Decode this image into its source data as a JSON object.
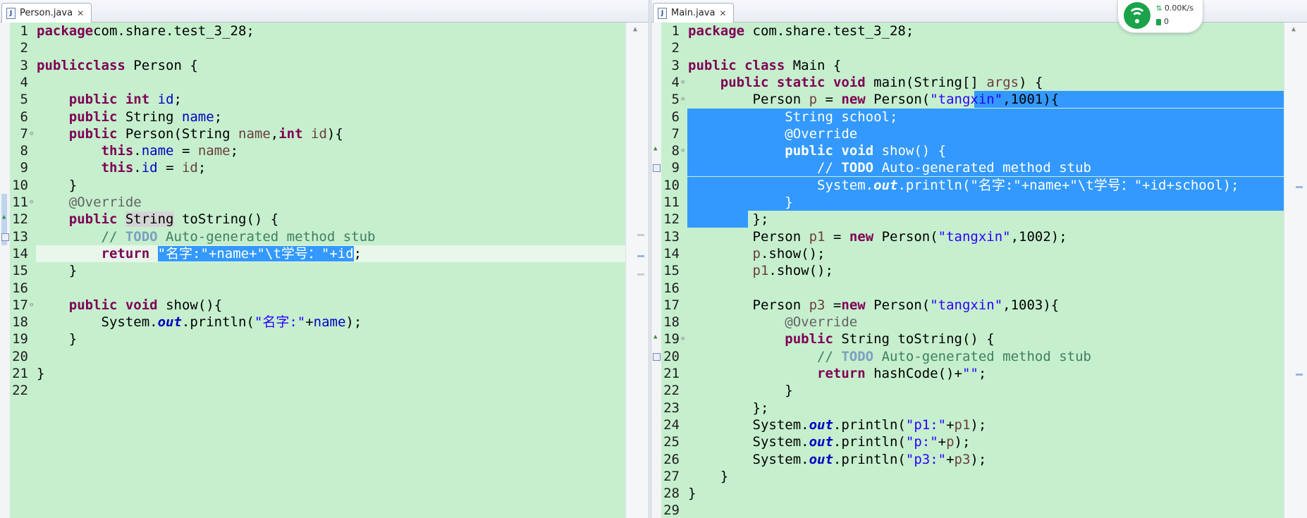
{
  "left_editor": {
    "tab_label": "Person.java",
    "line_numbers": [
      "1",
      "2",
      "3",
      "4",
      "5",
      "6",
      "7",
      "8",
      "9",
      "10",
      "11",
      "12",
      "13",
      "14",
      "15",
      "16",
      "17",
      "18",
      "19",
      "20",
      "21",
      "22"
    ],
    "lines": [
      [
        [
          "kw",
          "package"
        ],
        [
          "",
          "com.share.test_3_28;"
        ]
      ],
      [],
      [
        [
          "kw",
          "public"
        ],
        [
          "",
          ""
        ],
        [
          "kw",
          "class"
        ],
        [
          "",
          " Person {"
        ]
      ],
      [],
      [
        [
          "",
          "    "
        ],
        [
          "kw",
          "public"
        ],
        [
          "",
          " "
        ],
        [
          "kw",
          "int"
        ],
        [
          "",
          " "
        ],
        [
          "fld",
          "id"
        ],
        [
          "",
          ";"
        ]
      ],
      [
        [
          "",
          "    "
        ],
        [
          "kw",
          "public"
        ],
        [
          "",
          " String "
        ],
        [
          "fld",
          "name"
        ],
        [
          "",
          ";"
        ]
      ],
      [
        [
          "",
          "    "
        ],
        [
          "kw",
          "public"
        ],
        [
          "",
          " Person(String "
        ],
        [
          "vname",
          "name"
        ],
        [
          "",
          ","
        ],
        [
          "kw",
          "int"
        ],
        [
          "",
          " "
        ],
        [
          "vname",
          "id"
        ],
        [
          "",
          "){"
        ]
      ],
      [
        [
          "",
          "        "
        ],
        [
          "kw",
          "this"
        ],
        [
          "",
          "."
        ],
        [
          "fld",
          "name"
        ],
        [
          "",
          " = "
        ],
        [
          "vname",
          "name"
        ],
        [
          "",
          ";"
        ]
      ],
      [
        [
          "",
          "        "
        ],
        [
          "kw",
          "this"
        ],
        [
          "",
          "."
        ],
        [
          "fld",
          "id"
        ],
        [
          "",
          " = "
        ],
        [
          "vname",
          "id"
        ],
        [
          "",
          ";"
        ]
      ],
      [
        [
          "",
          "    }"
        ]
      ],
      [
        [
          "",
          "    "
        ],
        [
          "ann",
          "@Override"
        ]
      ],
      [
        [
          "",
          "    "
        ],
        [
          "kw",
          "public"
        ],
        [
          "",
          " "
        ],
        [
          "hl",
          "String"
        ],
        [
          "",
          " toString() {"
        ]
      ],
      [
        [
          "",
          "        "
        ],
        [
          "cm",
          "// "
        ],
        [
          "todo",
          "TODO"
        ],
        [
          "cm",
          " Auto-generated method stub"
        ]
      ],
      [
        [
          "",
          "        "
        ],
        [
          "kw",
          "return"
        ],
        [
          "",
          " "
        ],
        [
          "sel",
          "\"名字:\"+name+\"\\t学号：\"+id"
        ],
        [
          "",
          ";"
        ]
      ],
      [
        [
          "",
          "    }"
        ]
      ],
      [],
      [
        [
          "",
          "    "
        ],
        [
          "kw",
          "public"
        ],
        [
          "",
          " "
        ],
        [
          "kw",
          "void"
        ],
        [
          "",
          " show(){"
        ]
      ],
      [
        [
          "",
          "        System."
        ],
        [
          "sf",
          "out"
        ],
        [
          "",
          ".println("
        ],
        [
          "str",
          "\"名字:\""
        ],
        [
          "",
          "+"
        ],
        [
          "fld",
          "name"
        ],
        [
          "",
          ");"
        ]
      ],
      [
        [
          "",
          "    }"
        ]
      ],
      [],
      [
        [
          "",
          "}"
        ]
      ],
      []
    ]
  },
  "right_editor": {
    "tab_label": "Main.java",
    "line_numbers": [
      "1",
      "2",
      "3",
      "4",
      "5",
      "6",
      "7",
      "8",
      "9",
      "10",
      "11",
      "12",
      "13",
      "14",
      "15",
      "16",
      "17",
      "18",
      "19",
      "20",
      "21",
      "22",
      "23",
      "24",
      "25",
      "26",
      "27",
      "28",
      "29"
    ],
    "lines": [
      [
        [
          "kw",
          "package"
        ],
        [
          "",
          " com.share.test_3_28;"
        ]
      ],
      [],
      [
        [
          "kw",
          "public"
        ],
        [
          "",
          " "
        ],
        [
          "kw",
          "class"
        ],
        [
          "",
          " Main {"
        ]
      ],
      [
        [
          "",
          "    "
        ],
        [
          "kw",
          "public"
        ],
        [
          "",
          " "
        ],
        [
          "kw",
          "static"
        ],
        [
          "",
          " "
        ],
        [
          "kw",
          "void"
        ],
        [
          "",
          " main(String[] "
        ],
        [
          "vname",
          "args"
        ],
        [
          "",
          ") {"
        ]
      ],
      [
        [
          "",
          "        Person "
        ],
        [
          "vname",
          "p"
        ],
        [
          "",
          " = "
        ],
        [
          "kw",
          "new"
        ],
        [
          "",
          " Person("
        ],
        [
          "str",
          "\"tangxin\""
        ],
        [
          "",
          ",1001){"
        ]
      ],
      [
        [
          "",
          "            String "
        ],
        [
          "fld",
          "school"
        ],
        [
          "",
          ";"
        ]
      ],
      [
        [
          "",
          "            "
        ],
        [
          "ann",
          "@Override"
        ]
      ],
      [
        [
          "",
          "            "
        ],
        [
          "kw",
          "public"
        ],
        [
          "",
          " "
        ],
        [
          "kw",
          "void"
        ],
        [
          "",
          " show() {"
        ]
      ],
      [
        [
          "",
          "                "
        ],
        [
          "cm",
          "// "
        ],
        [
          "todo",
          "TODO"
        ],
        [
          "cm",
          " Auto-generated method stub"
        ]
      ],
      [
        [
          "",
          "                System."
        ],
        [
          "sf",
          "out"
        ],
        [
          "",
          ".println("
        ],
        [
          "str",
          "\"名字:\""
        ],
        [
          "",
          "+"
        ],
        [
          "fld",
          "name"
        ],
        [
          "",
          "+"
        ],
        [
          "str",
          "\"\\t学号：\""
        ],
        [
          "",
          "+"
        ],
        [
          "fld",
          "id"
        ],
        [
          "",
          "+"
        ],
        [
          "fld",
          "school"
        ],
        [
          "",
          ");"
        ]
      ],
      [
        [
          "",
          "            }"
        ]
      ],
      [
        [
          "",
          "        };"
        ]
      ],
      [
        [
          "",
          "        Person "
        ],
        [
          "vname",
          "p1"
        ],
        [
          "",
          " = "
        ],
        [
          "kw",
          "new"
        ],
        [
          "",
          " Person("
        ],
        [
          "str",
          "\"tangxin\""
        ],
        [
          "",
          ",1002);"
        ]
      ],
      [
        [
          "",
          "        "
        ],
        [
          "vname",
          "p"
        ],
        [
          "",
          ".show();"
        ]
      ],
      [
        [
          "",
          "        "
        ],
        [
          "vname",
          "p1"
        ],
        [
          "",
          ".show();"
        ]
      ],
      [],
      [
        [
          "",
          "        Person "
        ],
        [
          "vname",
          "p3"
        ],
        [
          "",
          " ="
        ],
        [
          "kw",
          "new"
        ],
        [
          "",
          " Person("
        ],
        [
          "str",
          "\"tangxin\""
        ],
        [
          "",
          ",1003){"
        ]
      ],
      [
        [
          "",
          "            "
        ],
        [
          "ann",
          "@Override"
        ]
      ],
      [
        [
          "",
          "            "
        ],
        [
          "kw",
          "public"
        ],
        [
          "",
          " String toString() {"
        ]
      ],
      [
        [
          "",
          "                "
        ],
        [
          "cm",
          "// "
        ],
        [
          "todo",
          "TODO"
        ],
        [
          "cm",
          " Auto-generated method stub"
        ]
      ],
      [
        [
          "",
          "                "
        ],
        [
          "kw",
          "return"
        ],
        [
          "",
          " hashCode()+"
        ],
        [
          "str",
          "\"\""
        ],
        [
          "",
          ";"
        ]
      ],
      [
        [
          "",
          "            }"
        ]
      ],
      [
        [
          "",
          "        };"
        ]
      ],
      [
        [
          "",
          "        System."
        ],
        [
          "sf",
          "out"
        ],
        [
          "",
          ".println("
        ],
        [
          "str",
          "\"p1:\""
        ],
        [
          "",
          "+"
        ],
        [
          "vname",
          "p1"
        ],
        [
          "",
          ");"
        ]
      ],
      [
        [
          "",
          "        System."
        ],
        [
          "sf",
          "out"
        ],
        [
          "",
          ".println("
        ],
        [
          "str",
          "\"p:\""
        ],
        [
          "",
          "+"
        ],
        [
          "vname",
          "p"
        ],
        [
          "",
          ");"
        ]
      ],
      [
        [
          "",
          "        System."
        ],
        [
          "sf",
          "out"
        ],
        [
          "",
          ".println("
        ],
        [
          "str",
          "\"p3:\""
        ],
        [
          "",
          "+"
        ],
        [
          "vname",
          "p3"
        ],
        [
          "",
          ");"
        ]
      ],
      [
        [
          "",
          "    }"
        ]
      ],
      [
        [
          "",
          "}"
        ]
      ],
      []
    ]
  },
  "network_widget": {
    "speed": "0.00K/s",
    "connections": "0"
  },
  "colors": {
    "editor_background": "#c6efce",
    "selection": "#3399ff",
    "keyword": "#7f0055",
    "string": "#2a00ff",
    "field": "#0000c0",
    "comment": "#3f7f5f"
  }
}
